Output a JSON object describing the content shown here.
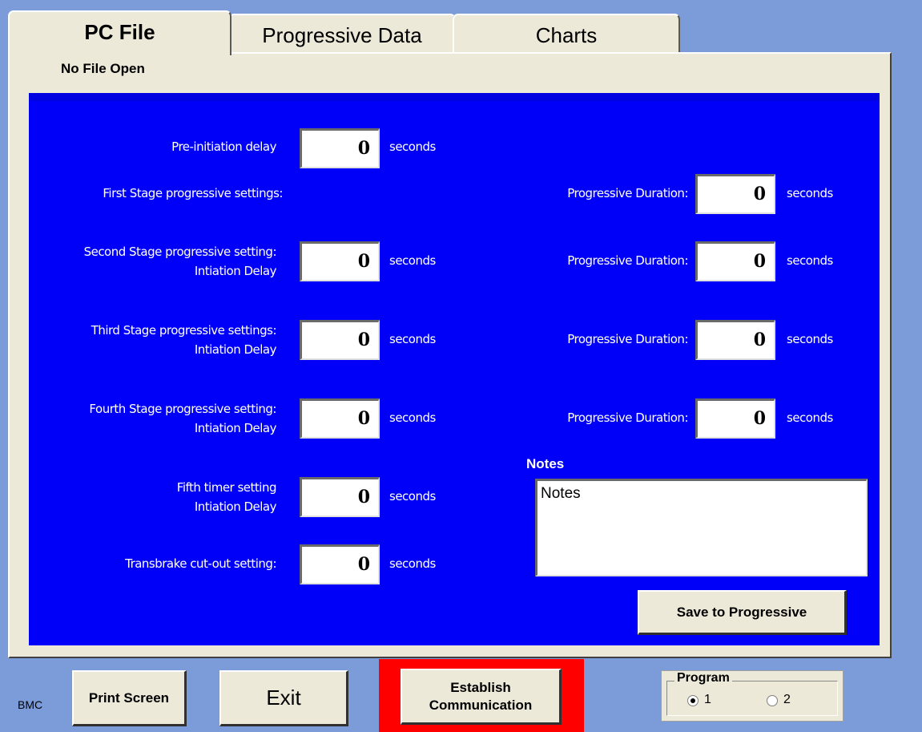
{
  "tabs": [
    {
      "label": "PC File",
      "active": true
    },
    {
      "label": "Progressive Data",
      "active": false
    },
    {
      "label": "Charts",
      "active": false
    }
  ],
  "file_status": "No File Open",
  "left_settings": [
    {
      "label_line1": "Pre-initiation delay",
      "label_line2": "",
      "value": "0",
      "unit": "seconds"
    },
    {
      "label_line1": "First Stage progressive settings:",
      "label_line2": "",
      "value": null,
      "unit": ""
    },
    {
      "label_line1": "Second Stage progressive setting:",
      "label_line2": "Intiation Delay",
      "value": "0",
      "unit": "seconds"
    },
    {
      "label_line1": "Third Stage progressive settings:",
      "label_line2": "Intiation Delay",
      "value": "0",
      "unit": "seconds"
    },
    {
      "label_line1": "Fourth Stage progressive setting:",
      "label_line2": "Intiation Delay",
      "value": "0",
      "unit": "seconds"
    },
    {
      "label_line1": "Fifth timer setting",
      "label_line2": "Intiation Delay",
      "value": "0",
      "unit": "seconds"
    },
    {
      "label_line1": "Transbrake cut-out setting:",
      "label_line2": "",
      "value": "0",
      "unit": "seconds"
    }
  ],
  "right_settings": [
    {
      "label": "Progressive Duration:",
      "value": "0",
      "unit": "seconds"
    },
    {
      "label": "Progressive Duration:",
      "value": "0",
      "unit": "seconds"
    },
    {
      "label": "Progressive Duration:",
      "value": "0",
      "unit": "seconds"
    },
    {
      "label": "Progressive Duration:",
      "value": "0",
      "unit": "seconds"
    }
  ],
  "notes": {
    "label": "Notes",
    "value": "Notes"
  },
  "buttons": {
    "save_progressive": "Save to Progressive",
    "print_screen": "Print Screen",
    "exit": "Exit",
    "establish_line1": "Establish",
    "establish_line2": "Communication"
  },
  "footer": {
    "brand": "BMC"
  },
  "program_group": {
    "title": "Program",
    "options": [
      {
        "label": "1",
        "checked": true
      },
      {
        "label": "2",
        "checked": false
      }
    ]
  },
  "colors": {
    "accent_blue": "#0000f8",
    "background": "#7b9bd9",
    "alert_red": "#ff0000"
  }
}
